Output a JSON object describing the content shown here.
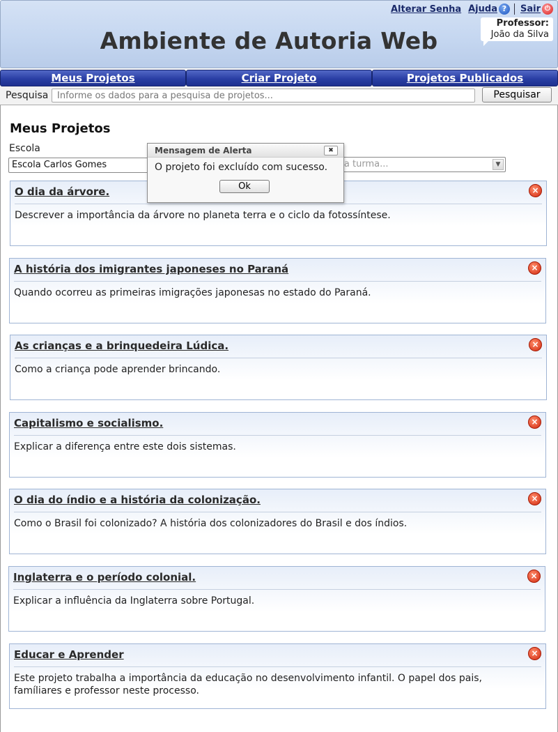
{
  "header": {
    "title": "Ambiente de Autoria Web",
    "links": {
      "alterar_senha": "Alterar Senha",
      "ajuda": "Ajuda",
      "sair": "Sair"
    },
    "professor_label": "Professor:",
    "professor_name": "João da Silva"
  },
  "nav": {
    "tabs": [
      "Meus Projetos",
      "Criar Projeto",
      "Projetos Publicados"
    ]
  },
  "search": {
    "label": "Pesquisa",
    "placeholder": "Informe os dados para a pesquisa de projetos...",
    "button": "Pesquisar"
  },
  "main": {
    "title": "Meus Projetos",
    "escola_label": "Escola",
    "escola_selected": "Escola Carlos Gomes",
    "turma_placeholder": "uma turma...",
    "projects": [
      {
        "title": "O dia da árvore.",
        "description": "Descrever a importância da árvore no planeta terra e o ciclo da fotossíntese."
      },
      {
        "title": "A história dos imigrantes japoneses no Paraná",
        "description": "Quando ocorreu as primeiras imigrações japonesas no estado do Paraná."
      },
      {
        "title": "As crianças e a brinquedeira Lúdica.",
        "description": "Como a criança pode aprender brincando."
      },
      {
        "title": "Capitalismo e socialismo.",
        "description": "Explicar a diferença entre este dois sistemas."
      },
      {
        "title": "O dia do índio e a história da colonização.",
        "description": "Como o Brasil foi colonizado? A história dos colonizadores do Brasil e dos índios."
      },
      {
        "title": "Inglaterra e o período colonial.",
        "description": "Explicar a influência da Inglaterra sobre Portugal."
      },
      {
        "title": "Educar e Aprender",
        "description": "Este projeto trabalha a importância da educação no desenvolvimento infantil. O papel dos pais, famíliares e professor neste processo."
      }
    ]
  },
  "alert": {
    "title": "Mensagem de Alerta",
    "message": "O projeto foi excluído com sucesso.",
    "ok_label": "Ok"
  }
}
